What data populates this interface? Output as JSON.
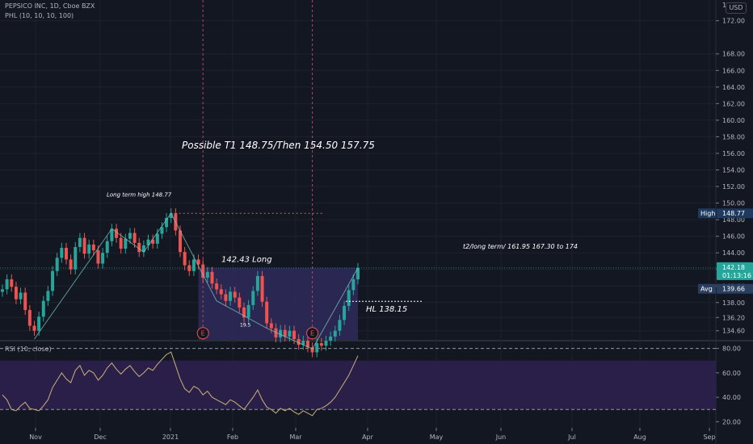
{
  "header": {
    "symbol_line": "PEPSICO INC, 1D, Cboe BZX",
    "indicator_line": "PHL (10, 10, 10, 100)",
    "rsi_label": "RSI (10, close)",
    "currency": "USD"
  },
  "colors": {
    "background": "#131722",
    "up": "#26a69a",
    "down": "#ef5350",
    "rsi_line": "#c8b27a",
    "rsi_band": "#2a1f48",
    "box_fill": "#2f2a5c",
    "pattern_line": "#80cbc4",
    "price_badge": "#26a69a",
    "avg_badge": "#2a3f5f"
  },
  "chart_data": [
    {
      "type": "candlestick",
      "title": "",
      "price_axis_ticks": [
        "172.00",
        "168.00",
        "166.00",
        "164.00",
        "162.00",
        "160.00",
        "158.00",
        "156.00",
        "154.00",
        "152.00",
        "150.00",
        "148.00",
        "146.00",
        "144.00",
        "142.00",
        "140.00",
        "138.00",
        "136.20",
        "134.60"
      ],
      "price_axis_top_tick": "1",
      "x_axis_ticks": [
        "Nov",
        "Dec",
        "2021",
        "Feb",
        "Mar",
        "Apr",
        "May",
        "Jun",
        "Jul",
        "Aug",
        "Sep"
      ],
      "ylim": [
        133.5,
        174.5
      ],
      "close_series": [
        139.6,
        140.8,
        139.9,
        138.4,
        139.2,
        137.1,
        135.2,
        134.6,
        136.3,
        138.2,
        139.4,
        141.8,
        143.4,
        144.6,
        143.2,
        142.0,
        144.7,
        145.8,
        143.9,
        145.0,
        144.3,
        142.7,
        144.0,
        145.4,
        146.9,
        145.8,
        144.5,
        145.7,
        146.4,
        145.2,
        144.1,
        144.9,
        145.6,
        145.1,
        146.3,
        147.1,
        148.2,
        148.77,
        146.7,
        144.1,
        142.5,
        141.8,
        143.2,
        142.6,
        141.0,
        141.7,
        140.3,
        139.6,
        139.0,
        138.2,
        139.3,
        138.6,
        137.4,
        136.2,
        137.7,
        139.4,
        141.2,
        138.1,
        135.5,
        134.9,
        133.8,
        134.7,
        133.9,
        134.6,
        133.6,
        132.9,
        133.4,
        132.6,
        132.0,
        133.1,
        132.8,
        133.4,
        133.9,
        134.6,
        135.9,
        137.6,
        139.5,
        140.8,
        142.18
      ],
      "annotations": [
        {
          "label": "Possible T1  148.75/Then 154.50  157.75",
          "x_index": 30,
          "price": 156.6
        },
        {
          "label": "Long term high  148.77",
          "x_index": 18,
          "price": 150.8
        },
        {
          "label": "142.43 Long",
          "x_index": 37,
          "price": 142.9
        },
        {
          "label": "HL 138.15",
          "x_index": 60,
          "price": 136.9
        },
        {
          "label": "t2/long term/  161.95    167.30 to 174",
          "x_index": 78,
          "price": 144.5
        },
        {
          "label": "19.5",
          "x_index": 41,
          "price": 135.1
        }
      ],
      "event_markers": [
        {
          "label": "E",
          "x_index": 44,
          "price": 134.5
        },
        {
          "label": "E",
          "x_index": 68,
          "price": 134.5
        }
      ],
      "levels": [
        {
          "name": "High",
          "value": "148.77",
          "price": 148.77
        },
        {
          "name": "",
          "value": "142.18",
          "price": 142.18,
          "countdown": "01:13:16"
        },
        {
          "name": "Avg",
          "value": "139.66",
          "price": 139.66
        },
        {
          "name": "",
          "value": "",
          "price": 138.15
        }
      ]
    },
    {
      "type": "line",
      "series": [
        {
          "name": "",
          "values": [
            42,
            38,
            30,
            29,
            33,
            36,
            31,
            30,
            29,
            33,
            38,
            48,
            54,
            60,
            55,
            52,
            62,
            66,
            58,
            62,
            60,
            54,
            58,
            64,
            68,
            63,
            59,
            63,
            66,
            61,
            57,
            60,
            64,
            62,
            67,
            71,
            75,
            77,
            66,
            55,
            47,
            44,
            49,
            47,
            42,
            45,
            40,
            38,
            36,
            34,
            38,
            36,
            33,
            30,
            35,
            40,
            46,
            38,
            32,
            30,
            27,
            31,
            29,
            31,
            28,
            26,
            29,
            27,
            25,
            30,
            31,
            33,
            36,
            40,
            46,
            52,
            58,
            66,
            74
          ]
        }
      ],
      "ylim": [
        15,
        85
      ],
      "y_ticks": [
        "80.00",
        "60.00",
        "40.00",
        "20.00"
      ],
      "band": [
        30,
        70
      ]
    }
  ]
}
